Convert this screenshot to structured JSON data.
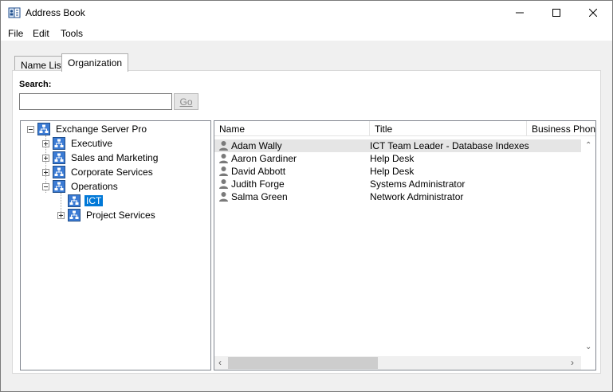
{
  "window": {
    "title": "Address Book"
  },
  "menu": {
    "file": "File",
    "edit": "Edit",
    "tools": "Tools"
  },
  "tabs": {
    "name_list": "Name List",
    "organization": "Organization"
  },
  "search": {
    "label": "Search:",
    "value": "",
    "go_label": "Go"
  },
  "tree": {
    "root": "Exchange Server Pro",
    "executive": "Executive",
    "sales": "Sales and Marketing",
    "corporate": "Corporate Services",
    "operations": "Operations",
    "ict": "ICT",
    "project": "Project Services"
  },
  "list": {
    "columns": {
      "name": "Name",
      "title": "Title",
      "phone": "Business Phone"
    },
    "rows": [
      {
        "name": "Adam Wally",
        "title": "ICT Team Leader - Database Indexes"
      },
      {
        "name": "Aaron Gardiner",
        "title": "Help Desk"
      },
      {
        "name": "David Abbott",
        "title": "Help Desk"
      },
      {
        "name": "Judith Forge",
        "title": "Systems Administrator"
      },
      {
        "name": "Salma Green",
        "title": "Network Administrator"
      }
    ]
  },
  "colors": {
    "selection": "#0078d7",
    "row_highlight": "#e5e5e5",
    "org_icon": "#3b7bd4"
  },
  "icons": {
    "app": "address-book-icon",
    "org": "org-chart-icon",
    "person": "person-icon"
  }
}
